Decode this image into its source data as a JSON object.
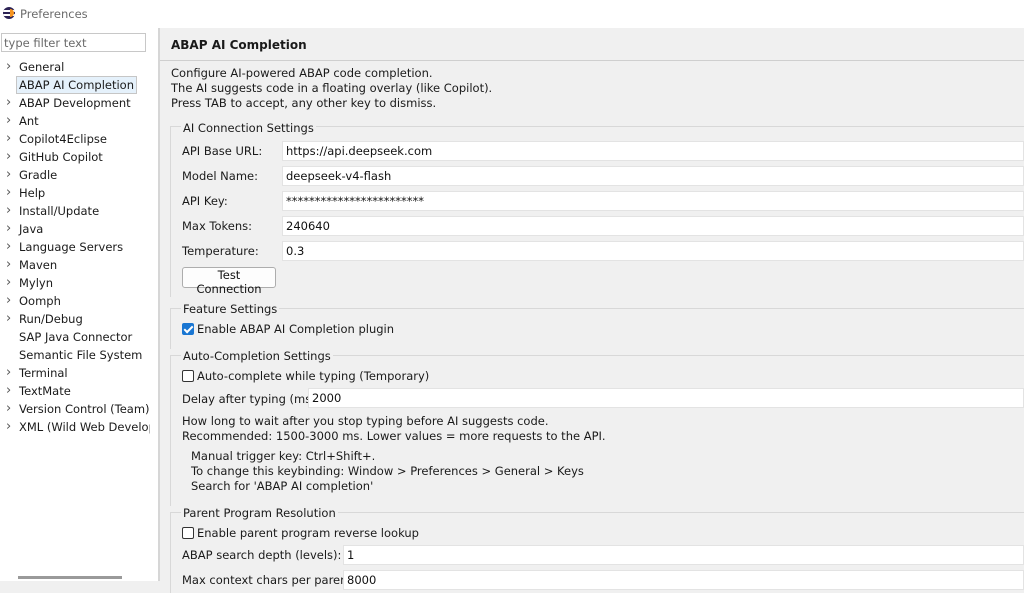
{
  "window": {
    "title": "Preferences"
  },
  "sidebar": {
    "filter_placeholder": "type filter text",
    "items": [
      {
        "label": "General",
        "expandable": true
      },
      {
        "label": "ABAP AI Completion",
        "expandable": false,
        "selected": true
      },
      {
        "label": "ABAP Development",
        "expandable": true
      },
      {
        "label": "Ant",
        "expandable": true
      },
      {
        "label": "Copilot4Eclipse",
        "expandable": true
      },
      {
        "label": "GitHub Copilot",
        "expandable": true
      },
      {
        "label": "Gradle",
        "expandable": true
      },
      {
        "label": "Help",
        "expandable": true
      },
      {
        "label": "Install/Update",
        "expandable": true
      },
      {
        "label": "Java",
        "expandable": true
      },
      {
        "label": "Language Servers",
        "expandable": true
      },
      {
        "label": "Maven",
        "expandable": true
      },
      {
        "label": "Mylyn",
        "expandable": true
      },
      {
        "label": "Oomph",
        "expandable": true
      },
      {
        "label": "Run/Debug",
        "expandable": true
      },
      {
        "label": "SAP Java Connector",
        "expandable": false
      },
      {
        "label": "Semantic File System",
        "expandable": false
      },
      {
        "label": "Terminal",
        "expandable": true
      },
      {
        "label": "TextMate",
        "expandable": true
      },
      {
        "label": "Version Control (Team)",
        "expandable": true
      },
      {
        "label": "XML (Wild Web Developer)",
        "expandable": true
      }
    ]
  },
  "page": {
    "title": "ABAP AI Completion",
    "description": [
      "Configure AI-powered ABAP code completion.",
      "The AI suggests code in a floating overlay (like Copilot).",
      "Press TAB to accept, any other key to dismiss."
    ]
  },
  "connection": {
    "group_title": "AI Connection Settings",
    "base_url_label": "API Base URL:",
    "base_url_value": "https://api.deepseek.com",
    "model_label": "Model Name:",
    "model_value": "deepseek-v4-flash",
    "api_key_label": "API Key:",
    "api_key_value": "************************",
    "max_tokens_label": "Max Tokens:",
    "max_tokens_value": "240640",
    "temperature_label": "Temperature:",
    "temperature_value": "0.3",
    "test_button_label": "Test Connection"
  },
  "features": {
    "group_title": "Feature Settings",
    "enable_plugin_label": "Enable ABAP AI Completion plugin",
    "enable_plugin_checked": true
  },
  "autocompletion": {
    "group_title": "Auto-Completion Settings",
    "autocomplete_label": "Auto-complete while typing (Temporary)",
    "autocomplete_checked": false,
    "delay_label": "Delay after typing (ms):",
    "delay_value": "2000",
    "help_line1": "How long to wait after you stop typing before AI suggests code.",
    "help_line2": "Recommended: 1500-3000 ms. Lower values = more requests to the API.",
    "trigger_line1": "Manual trigger key: Ctrl+Shift+.",
    "trigger_line2": "To change this keybinding: Window > Preferences > General > Keys",
    "trigger_line3": "Search for 'ABAP AI completion'"
  },
  "parent": {
    "group_title": "Parent Program Resolution",
    "reverse_lookup_label": "Enable parent program reverse lookup",
    "reverse_lookup_checked": false,
    "depth_label": "ABAP search depth (levels):",
    "depth_value": "1",
    "max_chars_label": "Max context chars per parent:",
    "max_chars_value": "8000"
  }
}
